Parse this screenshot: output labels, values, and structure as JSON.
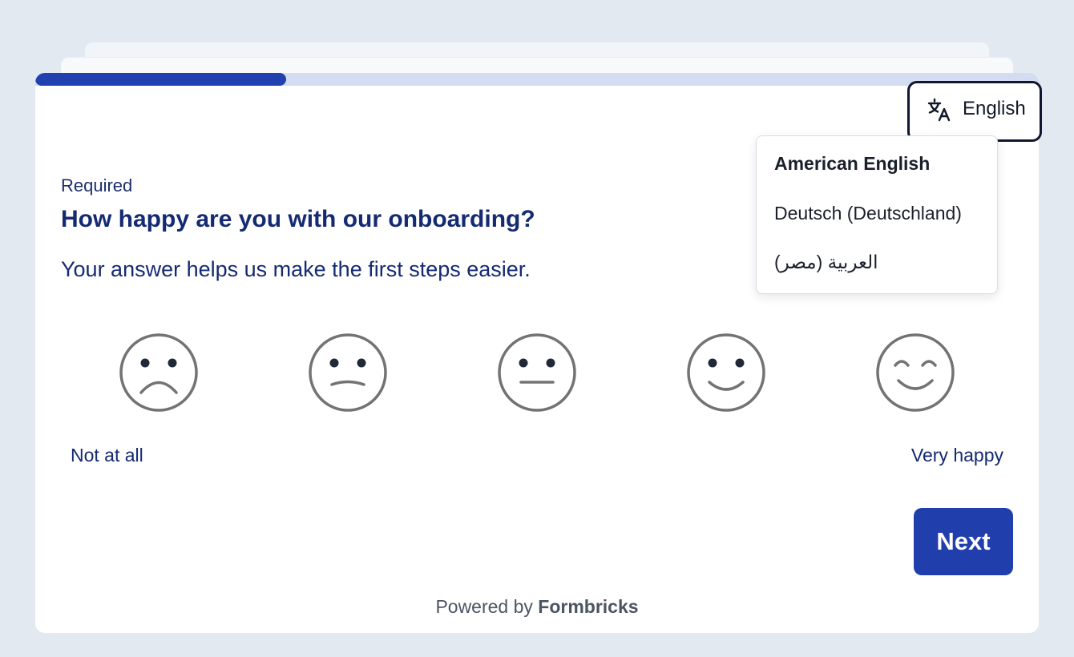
{
  "survey": {
    "progress_fraction": 0.25,
    "required_label": "Required",
    "question": "How happy are you with our onboarding?",
    "subheader": "Your answer helps us make the first steps easier.",
    "low_label": "Not at all",
    "high_label": "Very happy",
    "next_label": "Next",
    "powered_prefix": "Powered by",
    "powered_brand": "Formbricks"
  },
  "language": {
    "current": "English",
    "icon": "translate-icon",
    "options": [
      {
        "label": "American English",
        "selected": true
      },
      {
        "label": "Deutsch (Deutschland)",
        "selected": false
      },
      {
        "label": "العربية (مصر)",
        "selected": false
      }
    ]
  },
  "rating": {
    "scale": 5,
    "faces": [
      "very-sad-face-icon",
      "sad-face-icon",
      "neutral-face-icon",
      "smile-face-icon",
      "very-happy-face-icon"
    ]
  },
  "colors": {
    "brand": "#213ead",
    "progress_track": "#d4dcf1",
    "text": "#142a72"
  }
}
